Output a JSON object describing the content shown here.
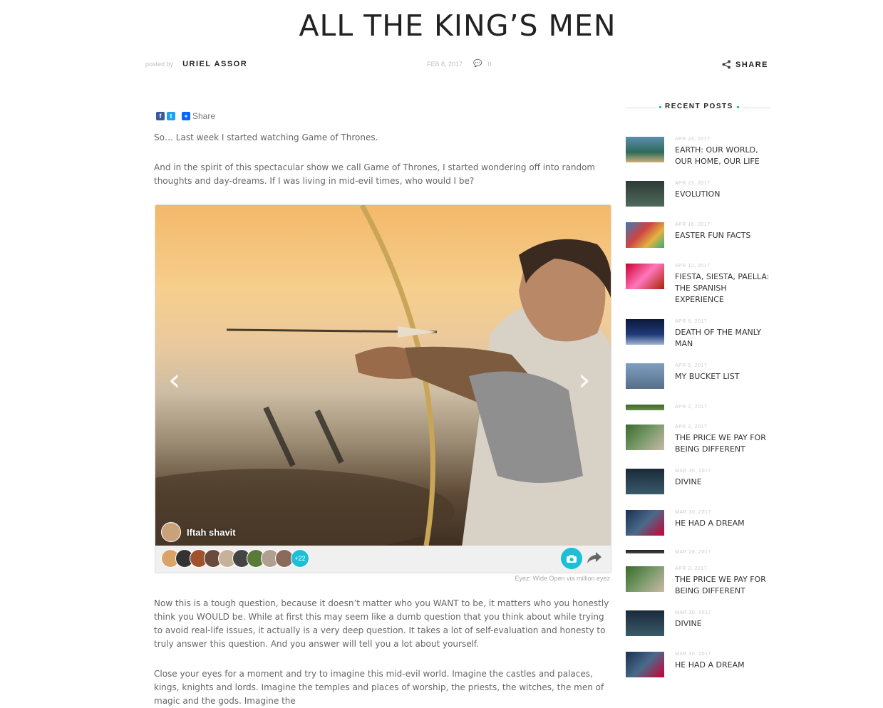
{
  "post": {
    "title": "ALL THE KING’S MEN",
    "posted_by_label": "posted by",
    "author": "URIEL ASSOR",
    "date": "FEB 8, 2017",
    "comment_count": "0",
    "share_label": "SHARE",
    "inline_share_label": "Share",
    "paragraphs": [
      "So… Last week I started watching Game of Thrones.",
      "And in the spirit of this spectacular show we call Game of Thrones, I started wondering off into random thoughts and day-dreams. If I was living in mid-evil times, who would I be?",
      "Now this is a tough question, because it doesn’t matter who you WANT to be, it matters who you honestly think you WOULD be. While at first this may seem like a dumb question that you think about while trying to avoid real-life issues, it actually is a very deep question. It takes a lot of self-evaluation and honesty to truly answer this question. And you answer will tell you a lot about yourself.",
      "Close your eyes for a moment and try to imagine this mid-evil world. Imagine the castles and palaces, kings, knights and lords. Imagine the temples and places of worship, the priests, the witches, the men of magic and the gods. Imagine the"
    ]
  },
  "gallery": {
    "photographer": "Iftah shavit",
    "more_count": "+22",
    "caption": "Eyez: Wide Open via million eyez"
  },
  "sidebar": {
    "heading": "RECENT POSTS",
    "posts": [
      {
        "date": "APR 24, 2017",
        "title": "EARTH: OUR WORLD, OUR HOME, OUR LIFE"
      },
      {
        "date": "APR 23, 2017",
        "title": "EVOLUTION"
      },
      {
        "date": "APR 16, 2017",
        "title": "EASTER FUN FACTS"
      },
      {
        "date": "APR 12, 2017",
        "title": "FIESTA, SIESTA, PAELLA: THE SPANISH EXPERIENCE"
      },
      {
        "date": "APR 9, 2017",
        "title": "DEATH OF THE MANLY MAN"
      },
      {
        "date": "APR 5, 2017",
        "title": "MY BUCKET LIST"
      },
      {
        "date": "APR 2, 2017",
        "title": ""
      },
      {
        "date": "APR 2, 2017",
        "title": "THE PRICE WE PAY FOR BEING DIFFERENT"
      },
      {
        "date": "MAR 30, 2017",
        "title": "DIVINE"
      },
      {
        "date": "MAR 30, 2017",
        "title": "HE HAD A DREAM"
      },
      {
        "date": "MAR 28, 2017",
        "title": ""
      },
      {
        "date": "APR 2, 2017",
        "title": "THE PRICE WE PAY FOR BEING DIFFERENT"
      },
      {
        "date": "MAR 30, 2017",
        "title": "DIVINE"
      },
      {
        "date": "MAR 30, 2017",
        "title": "HE HAD A DREAM"
      }
    ]
  },
  "colors": {
    "accent": "#1cc0d6",
    "facebook": "#3b5998",
    "twitter": "#1da1f2"
  }
}
